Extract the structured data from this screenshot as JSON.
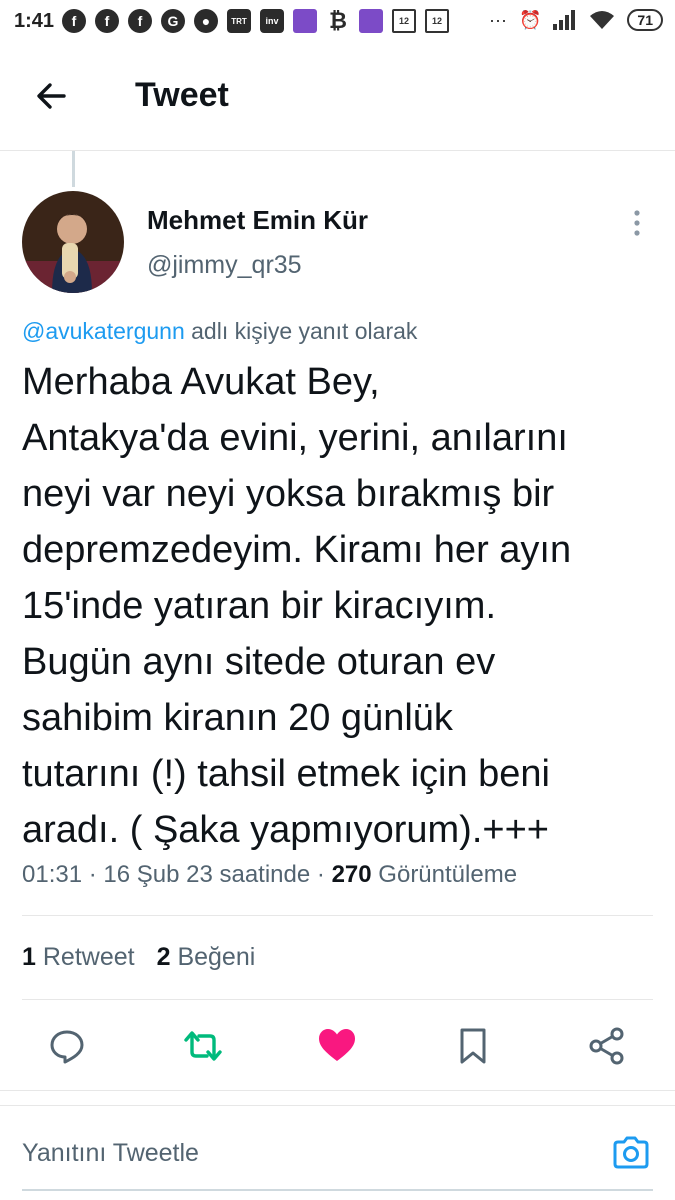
{
  "status_bar": {
    "time": "1:41",
    "left_icons": [
      "facebook-icon",
      "facebook-icon",
      "facebook-icon",
      "google-icon",
      "chat-bubble-icon",
      "trt-spor-icon",
      "investing-icon",
      "app-purple-icon",
      "bitcoin-icon",
      "app-purple-icon",
      "puzzle-icon",
      "puzzle-icon"
    ],
    "battery": "71"
  },
  "header": {
    "title": "Tweet"
  },
  "tweet": {
    "author_name": "Mehmet Emin Kür",
    "author_handle": "@jimmy_qr35",
    "reply_mention": "@avukatergunn",
    "reply_suffix": "adlı kişiye yanıt olarak",
    "text": "Merhaba Avukat Bey,\nAntakya'da evini, yerini, anılarını\nneyi var neyi yoksa bırakmış bir\ndepremzedeyim. Kiramı her ayın\n15'inde yatıran bir kiracıyım.\nBugün aynı sitede oturan ev\nsahibim kiranın 20 günlük\ntutarını (!) tahsil etmek için beni\naradı. ( Şaka yapmıyorum).+++",
    "timestamp": "01:31 · 16 Şub 23 saatinde",
    "separator": "·",
    "views_count": "270",
    "views_label": "Görüntüleme"
  },
  "stats": {
    "retweets_count": "1",
    "retweets_label": "Retweet",
    "likes_count": "2",
    "likes_label": "Beğeni"
  },
  "actions": {
    "reply_icon": "comment-icon",
    "retweet_icon": "retweet-icon",
    "like_icon": "heart-icon",
    "bookmark_icon": "bookmark-icon",
    "share_icon": "share-icon"
  },
  "compose": {
    "placeholder": "Yanıtını Tweetle"
  },
  "colors": {
    "link": "#1d9bf0",
    "retweet_active": "#00ba7c",
    "like_active": "#f91880",
    "secondary_text": "#536471"
  }
}
